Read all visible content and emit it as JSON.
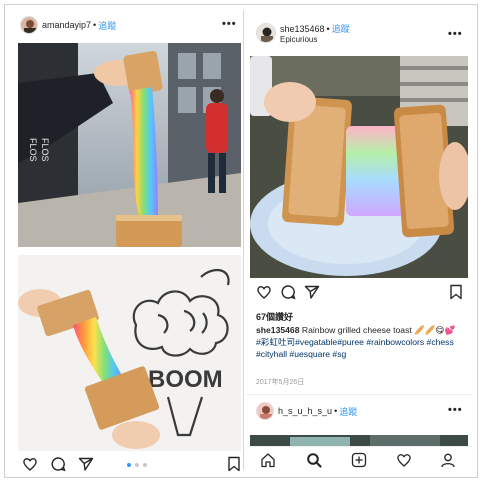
{
  "left_post": {
    "username": "amandayip7",
    "follow_label": "追蹤",
    "separator": "•",
    "more_glyph": "•••",
    "sign_text_1": "FLOS",
    "sign_text_2": "FLOS",
    "wall_text": "BOOM",
    "carousel": {
      "total": 3,
      "active": 0
    },
    "icons": [
      "heart-icon",
      "comment-icon",
      "share-icon",
      "bookmark-icon"
    ]
  },
  "right_post": {
    "username": "she135468",
    "follow_label": "追蹤",
    "separator": "•",
    "location": "Epicurious",
    "more_glyph": "•••",
    "likes": "67個讚好",
    "caption_user": "she135468",
    "caption_text": "Rainbow grilled cheese toast",
    "caption_emoji": "🥖🥖😋💕",
    "hashtags_line1": "#彩虹吐司#vegatable#puree #rainbowcolors #chess",
    "hashtags_line2": "#cityhall #uesquare #sg",
    "date": "2017年5月26日",
    "icons": [
      "heart-icon",
      "comment-icon",
      "share-icon",
      "bookmark-icon"
    ]
  },
  "next_post": {
    "username": "h_s_u_h_s_u",
    "follow_label": "追蹤",
    "separator": "•",
    "more_glyph": "•••"
  },
  "tabbar": {
    "icons": [
      "home-icon",
      "search-icon",
      "new-post-icon",
      "activity-icon",
      "profile-icon"
    ]
  },
  "colors": {
    "link_blue": "#3897f0",
    "hashtag": "#003569",
    "rainbow": [
      "#ff5a6e",
      "#ff9a3c",
      "#ffe14d",
      "#8be06b",
      "#5ecbff",
      "#8c7bff"
    ]
  }
}
